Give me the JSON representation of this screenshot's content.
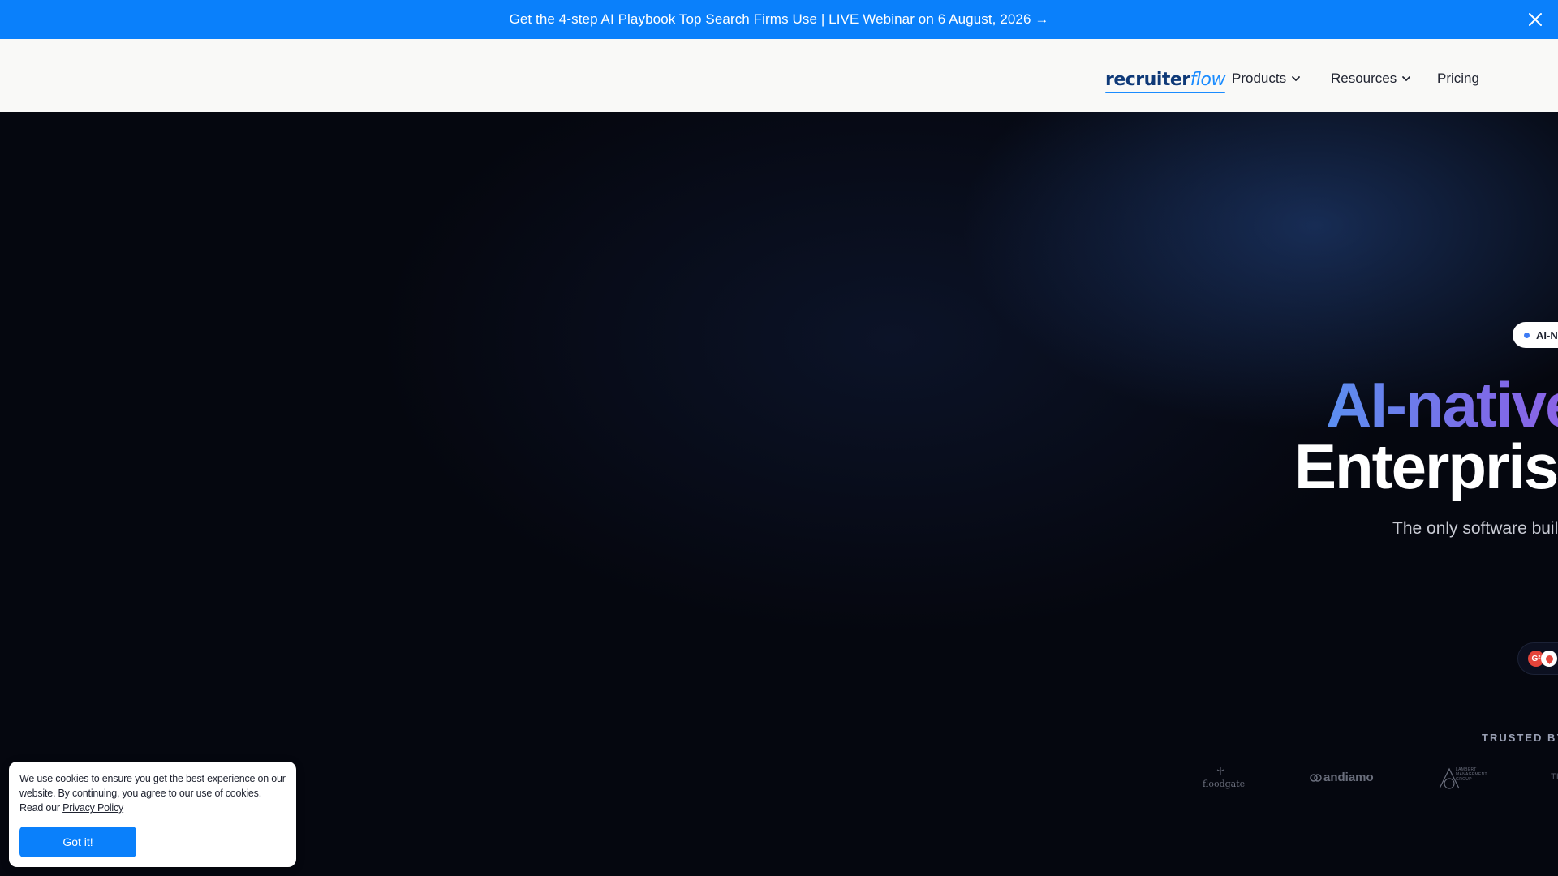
{
  "announcement": {
    "text": "Get the 4-step AI Playbook Top Search Firms Use | LIVE Webinar on 6 August, 2026 →",
    "close_icon": "close-icon"
  },
  "nav": {
    "logo_part1": "recruiter",
    "logo_part2": "flow",
    "items": [
      {
        "label": "Products",
        "has_dropdown": true
      },
      {
        "label": "Resources",
        "has_dropdown": true
      },
      {
        "label": "Pricing",
        "has_dropdown": false
      }
    ]
  },
  "hero": {
    "badge": "AI-N",
    "headline_line1": "AI-native",
    "headline_line2": "Enterprise",
    "subheadline": "The only software built",
    "trusted_label": "TRUSTED BY",
    "client_logos": [
      "floodgate",
      "andiamo",
      "LAMBERT MANAGEMENT GROUP",
      "TI"
    ]
  },
  "cookie": {
    "text": "We use cookies to ensure you get the best experience on our website. By continuing, you agree to our use of cookies.",
    "read_prefix": "Read our",
    "policy_link": "Privacy Policy",
    "button": "Got it!"
  },
  "colors": {
    "accent": "#0a80fb",
    "hero_bg": "#05070f",
    "nav_bg": "#f9f9f7",
    "headline_gradient": [
      "#5b8ff0",
      "#8d62e6"
    ]
  }
}
